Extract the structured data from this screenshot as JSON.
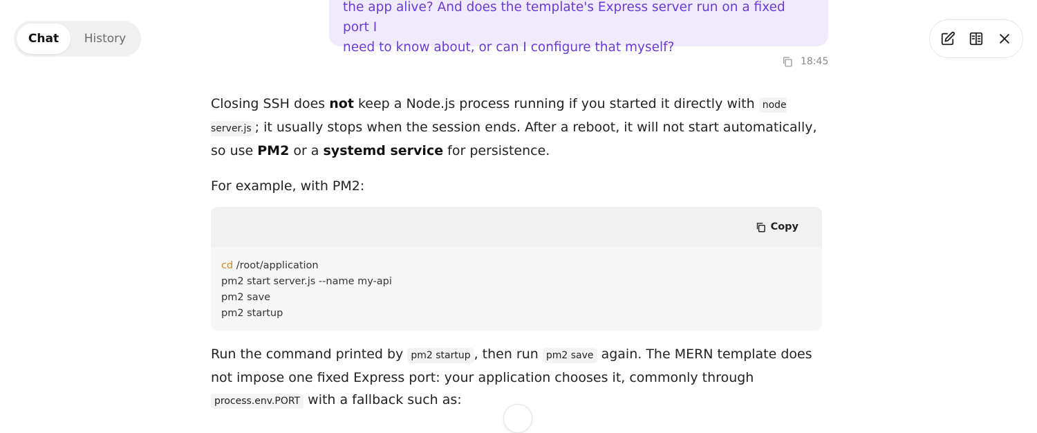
{
  "tabs": {
    "chat": "Chat",
    "history": "History"
  },
  "toolbar": {
    "icons": [
      "new-chat-icon",
      "reader-icon",
      "close-icon"
    ]
  },
  "user_message": {
    "text_line1": "the app alive? And does the template's Express server run on a fixed port I",
    "text_line2": "need to know about, or can I configure that myself?",
    "time": "18:45"
  },
  "answer": {
    "p1_a": "Closing SSH does ",
    "p1_b": "not",
    "p1_c": " keep a Node.js process running if you started it directly with ",
    "p1_code": "node server.js",
    "p1_d": "; it usually stops when the session ends. After a reboot, it will not start automatically, so use ",
    "p1_e": "PM2",
    "p1_f": " or a ",
    "p1_g": "systemd service",
    "p1_h": " for persistence.",
    "p2": "For example, with PM2:",
    "code": {
      "copy_label": "Copy",
      "line1_kw": "cd",
      "line1_rest": " /root/application",
      "line2": "pm2 start server.js --name my-api",
      "line3": "pm2 save",
      "line4": "pm2 startup"
    },
    "p3_a": "Run the command printed by ",
    "p3_code1": "pm2 startup",
    "p3_b": ", then run ",
    "p3_code2": "pm2 save",
    "p3_c": " again. The MERN template does not impose one fixed Express port: your application chooses it, commonly through ",
    "p3_code3": "process.env.PORT",
    "p3_d": " with a fallback such as:"
  },
  "colors": {
    "accent": "#6a3bd9",
    "user_bubble": "#efeafc",
    "keyword": "#d08a1f"
  }
}
